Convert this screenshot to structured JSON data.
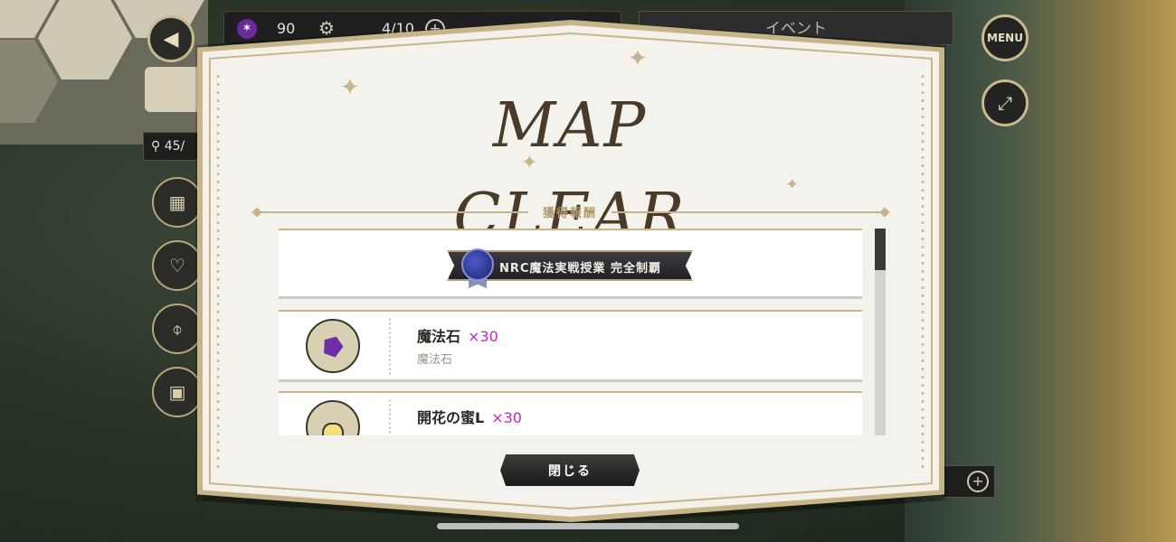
{
  "hud": {
    "gem_count": "90",
    "stamina": "4/10",
    "event_label": "イベント",
    "menu_label": "MENU",
    "left_counter": "45/",
    "icons": [
      "back-icon",
      "gem-icon",
      "gear-icon",
      "plus-icon",
      "expand-icon",
      "card-icon",
      "hanger-icon",
      "mirror-icon",
      "chest-icon"
    ]
  },
  "modal": {
    "title": "MAP CLEAR",
    "section_label": "獲得報酬",
    "badge_label": "NRC魔法実戦授業 完全制覇",
    "rewards": [
      {
        "name": "魔法石",
        "qty": "×30",
        "sub": "魔法石",
        "icon": "magic-stone-icon"
      },
      {
        "name": "開花の蜜L",
        "qty": "×30",
        "sub": "",
        "icon": "honey-jar-icon"
      }
    ],
    "close_label": "閉じる"
  },
  "colors": {
    "frame_gold": "#c8b489",
    "qty_magenta": "#c128c4",
    "title_brown": "#4a3a28",
    "panel_bg": "#f3f1ea"
  }
}
